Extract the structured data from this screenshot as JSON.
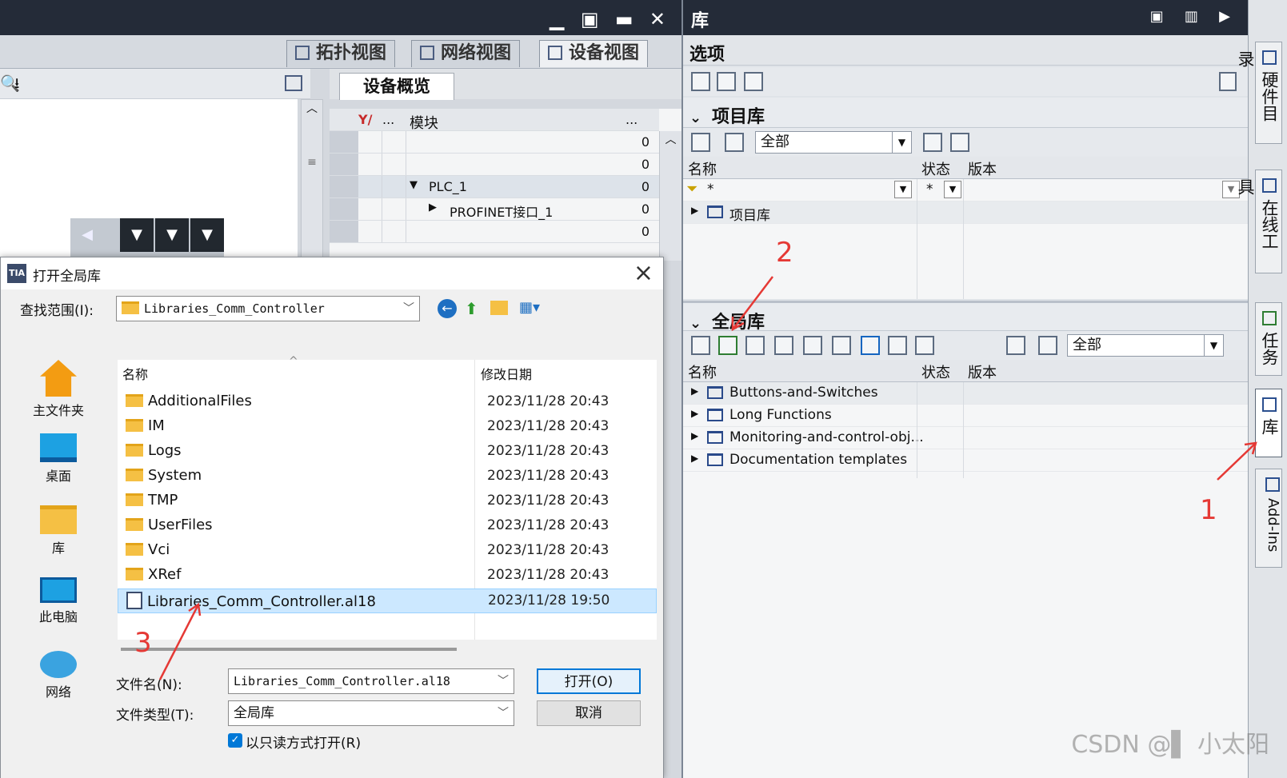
{
  "editor": {
    "tabs": {
      "topology": "拓扑视图",
      "network": "网络视图",
      "device": "设备视图"
    },
    "overview_tab": "设备概览",
    "overview_header": {
      "dots": "...",
      "module": "模块",
      "more": "..."
    },
    "overview_rows": [
      {
        "name": "",
        "value": "0",
        "expand": ""
      },
      {
        "name": "",
        "value": "0",
        "expand": ""
      },
      {
        "name": "PLC_1",
        "value": "0",
        "expand": "▼"
      },
      {
        "name": "PROFINET接口_1",
        "value": "0",
        "expand": "▶"
      },
      {
        "name": "",
        "value": "0",
        "expand": ""
      }
    ]
  },
  "dialog": {
    "title": "打开全局库",
    "look_in_label": "查找范围(I):",
    "look_in_value": "Libraries_Comm_Controller",
    "nav": [
      "主文件夹",
      "桌面",
      "库",
      "此电脑",
      "网络"
    ],
    "col_name": "名称",
    "col_date": "修改日期",
    "files": [
      {
        "name": "AdditionalFiles",
        "date": "2023/11/28 20:43"
      },
      {
        "name": "IM",
        "date": "2023/11/28 20:43"
      },
      {
        "name": "Logs",
        "date": "2023/11/28 20:43"
      },
      {
        "name": "System",
        "date": "2023/11/28 20:43"
      },
      {
        "name": "TMP",
        "date": "2023/11/28 20:43"
      },
      {
        "name": "UserFiles",
        "date": "2023/11/28 20:43"
      },
      {
        "name": "Vci",
        "date": "2023/11/28 20:43"
      },
      {
        "name": "XRef",
        "date": "2023/11/28 20:43"
      },
      {
        "name": "Libraries_Comm_Controller.al18",
        "date": "2023/11/28 19:50"
      }
    ],
    "filename_label": "文件名(N):",
    "filename_value": "Libraries_Comm_Controller.al18",
    "filetype_label": "文件类型(T):",
    "filetype_value": "全局库",
    "readonly_label": "以只读方式打开(R)",
    "open_button": "打开(O)",
    "cancel_button": "取消"
  },
  "library": {
    "title": "库",
    "options": "选项",
    "project_lib": {
      "header": "项目库",
      "filter": "全部",
      "col_name": "名称",
      "col_status": "状态",
      "col_version": "版本",
      "filter_star": "*",
      "filter_star2": "*",
      "root": "项目库"
    },
    "global_lib": {
      "header": "全局库",
      "filter": "全部",
      "col_name": "名称",
      "col_status": "状态",
      "col_version": "版本",
      "items": [
        "Buttons-and-Switches",
        "Long Functions",
        "Monitoring-and-control-obj...",
        "Documentation templates"
      ]
    }
  },
  "rail_tabs": [
    "硬件目录",
    "在线工具",
    "任务",
    "库",
    "Add-Ins"
  ],
  "annotations": [
    "1",
    "2",
    "3"
  ],
  "watermark": "CSDN @▌ 小太阳",
  "colors": {
    "title_bar": "#242b38",
    "selection": "#cce8ff",
    "annotation": "#e53935",
    "accent": "#0078d7"
  }
}
